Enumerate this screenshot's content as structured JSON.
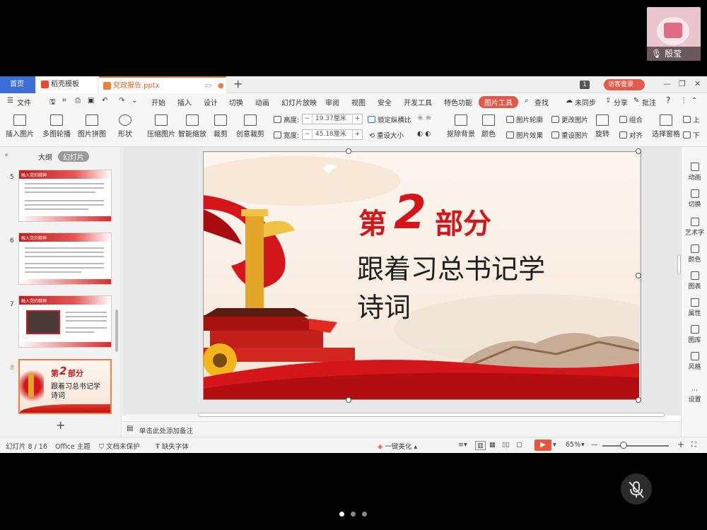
{
  "video": {
    "participant_name": "殷莹"
  },
  "tabs": {
    "home": "首页",
    "template": "稻壳模板",
    "document": "党政报告.pptx",
    "plus": "+"
  },
  "title_bar": {
    "badge": "1",
    "login": "访客登录"
  },
  "menu": {
    "file": "文件",
    "items": [
      "开始",
      "插入",
      "设计",
      "切换",
      "动画",
      "幻灯片放映",
      "审阅",
      "视图",
      "安全",
      "开发工具",
      "特色功能"
    ],
    "picture_tools": "图片工具",
    "search": "查找",
    "sync": "未同步",
    "share": "分享",
    "comment": "批注",
    "help": "?"
  },
  "ribbon": {
    "insert_picture": "插入图片",
    "multi_outline": "多图轮播",
    "picture_collage": "图片拼图",
    "shape": "形状",
    "compress": "压缩图片",
    "smart_scale": "智能缩放",
    "crop": "裁剪",
    "creative_crop": "创意裁剪",
    "height_label": "高度:",
    "height_value": "19.37厘米",
    "width_label": "宽度:",
    "width_value": "45.18厘米",
    "lock_ratio": "锁定纵横比",
    "reset_size": "重设大小",
    "remove_bg": "抠除背景",
    "color": "颜色",
    "picture_outline": "图片轮廓",
    "picture_effect": "图片效果",
    "change_picture": "更改图片",
    "reset_picture": "重设图片",
    "rotate": "旋转",
    "group": "组合",
    "align": "对齐",
    "selection_pane": "选择窗格",
    "up": "上",
    "down": "下"
  },
  "left_panel": {
    "outline": "大纲",
    "slides": "幻灯片",
    "thumbs": [
      {
        "num": "5",
        "banner": "融入党的精神"
      },
      {
        "num": "6",
        "banner": "融入党的精神"
      },
      {
        "num": "7",
        "banner": "融入党的精神"
      },
      {
        "num": "8",
        "title_part": "第",
        "title_num": "2",
        "title_rest": "部分",
        "line1": "跟着习总书记学",
        "line2": "诗词"
      }
    ],
    "add": "+"
  },
  "slide": {
    "part_prefix": "第",
    "part_number": "2",
    "part_suffix": "部分",
    "title_line1": "跟着习总书记学",
    "title_line2": "诗词",
    "colors": {
      "red": "#d4161b",
      "gold": "#e8b323"
    }
  },
  "right_rail": [
    "动画",
    "切换",
    "艺术字",
    "颜色",
    "图表",
    "属性",
    "图库",
    "风格",
    "设置"
  ],
  "notes": {
    "placeholder": "单击此处添加备注"
  },
  "status": {
    "slide_count": "幻灯片 8 / 16",
    "theme": "Office 主题",
    "protect": "文档未保护",
    "missing_font": "缺失字体",
    "beautify": "一键美化",
    "zoom": "65%"
  }
}
